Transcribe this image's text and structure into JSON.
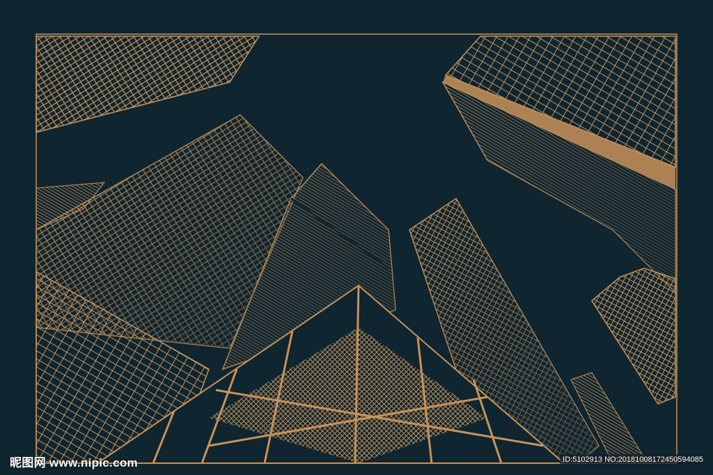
{
  "image": {
    "subject": "line-art skyscrapers viewed from below",
    "colors": {
      "background": "#0f2530",
      "gold": "#c8935a",
      "gold_light": "#e0a664"
    }
  },
  "watermark": {
    "site": "昵图网 www.nipic.com",
    "id_text": "ID:5102913 NO:20181008172450594085"
  }
}
